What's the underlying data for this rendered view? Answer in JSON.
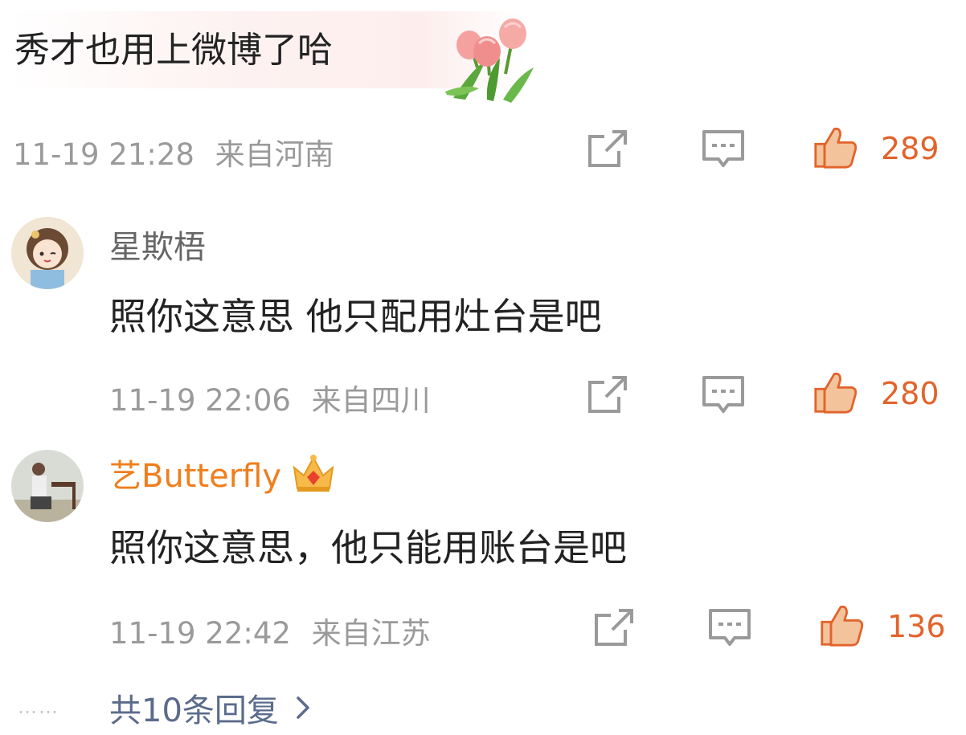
{
  "main_comment": {
    "text": "秀才也用上微博了哈",
    "sticker_icon": "tulip-sticker",
    "time": "11-19 21:28",
    "location": "来自河南",
    "likes": "289"
  },
  "replies": [
    {
      "username": "星欺梧",
      "text": "照你这意思  他只配用灶台是吧",
      "time": "11-19 22:06",
      "location": "来自四川",
      "likes": "280"
    },
    {
      "username": "艺Butterfly",
      "badge_icon": "crown-badge-icon",
      "text": "照你这意思，他只能用账台是吧",
      "time": "11-19 22:42",
      "location": "来自江苏",
      "likes": "136"
    }
  ],
  "more_replies": {
    "label": "共10条回复",
    "dots": "……"
  },
  "colors": {
    "like": "#e2632b",
    "vip_name": "#f07e1d",
    "link": "#5b6b8c",
    "meta": "#9a9a9a"
  }
}
